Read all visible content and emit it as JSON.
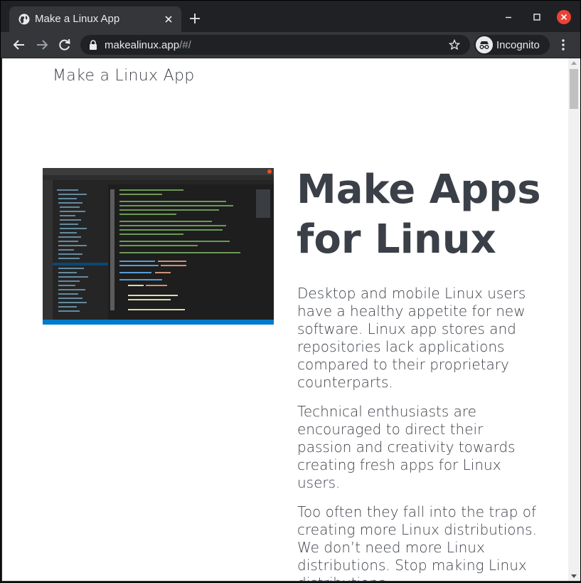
{
  "browser": {
    "tab": {
      "title": "Make a Linux App",
      "favicon": "globe-icon",
      "close": "close-icon"
    },
    "new_tab": "plus-icon",
    "window_controls": [
      "minimize-icon",
      "maximize-icon",
      "close-icon"
    ],
    "address": {
      "host": "makealinux.app",
      "path": "/#/"
    },
    "profile_label": "Incognito",
    "accent_close": "#e94235"
  },
  "page": {
    "site_title": "Make a Linux App",
    "hero": {
      "heading": "Make Apps for Linux",
      "image": "vscode-editor-screenshot"
    },
    "paragraphs": [
      "Desktop and mobile Linux users have a healthy appetite for new software. Linux app stores and repositories lack applications compared to their proprietary counterparts.",
      "Technical enthusiasts are encouraged to direct their passion and creativity towards creating fresh apps for Linux users.",
      "Too often they fall into the trap of creating more Linux distributions. We don’t need more Linux distributions. Stop making Linux distributions"
    ],
    "colors": {
      "text": "#3b4048",
      "background": "#ffffff",
      "editor_bg": "#1e1e1e",
      "editor_status": "#007acc"
    }
  }
}
